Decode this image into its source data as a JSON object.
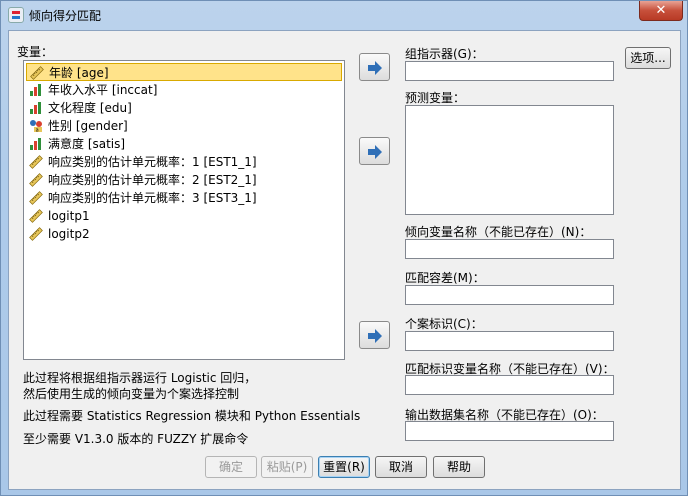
{
  "window": {
    "title": "倾向得分匹配",
    "close_glyph": "✕"
  },
  "variables": {
    "label": "变量：",
    "items": [
      {
        "label": "年龄 [age]",
        "icon": "scale-ruler-icon",
        "selected": true
      },
      {
        "label": "年收入水平 [inccat]",
        "icon": "ordinal-bars-icon"
      },
      {
        "label": "文化程度 [edu]",
        "icon": "ordinal-bars-icon"
      },
      {
        "label": "性别 [gender]",
        "icon": "nominal-icon"
      },
      {
        "label": "满意度 [satis]",
        "icon": "ordinal-bars-icon"
      },
      {
        "label": "响应类别的估计单元概率：1 [EST1_1]",
        "icon": "scale-ruler-icon"
      },
      {
        "label": "响应类别的估计单元概率：2 [EST2_1]",
        "icon": "scale-ruler-icon"
      },
      {
        "label": "响应类别的估计单元概率：3 [EST3_1]",
        "icon": "scale-ruler-icon"
      },
      {
        "label": "logitp1",
        "icon": "scale-ruler-icon"
      },
      {
        "label": "logitp2",
        "icon": "scale-ruler-icon"
      }
    ]
  },
  "fields": {
    "group_indicator": "组指示器(G)：",
    "predictors": "预测变量：",
    "propensity_name": "倾向变量名称（不能已存在）(N)：",
    "match_tolerance": "匹配容差(M)：",
    "case_id": "个案标识(C)：",
    "match_id_name": "匹配标识变量名称（不能已存在）(V)：",
    "output_dataset": "输出数据集名称（不能已存在）(O)："
  },
  "info": {
    "line1": "此过程将根据组指示器运行 Logistic 回归，",
    "line2": "然后使用生成的倾向变量为个案选择控制",
    "line3": "此过程需要 Statistics Regression 模块和 Python Essentials",
    "line4": "至少需要 V1.3.0 版本的 FUZZY 扩展命令"
  },
  "buttons": {
    "options": "选项...",
    "ok": "确定",
    "paste": "粘贴(P)",
    "reset": "重置(R)",
    "cancel": "取消",
    "help": "帮助"
  },
  "colors": {
    "arrow_blue": "#2f6fb7",
    "selection_fill": "#ffe38a",
    "close_red": "#c7503b"
  }
}
